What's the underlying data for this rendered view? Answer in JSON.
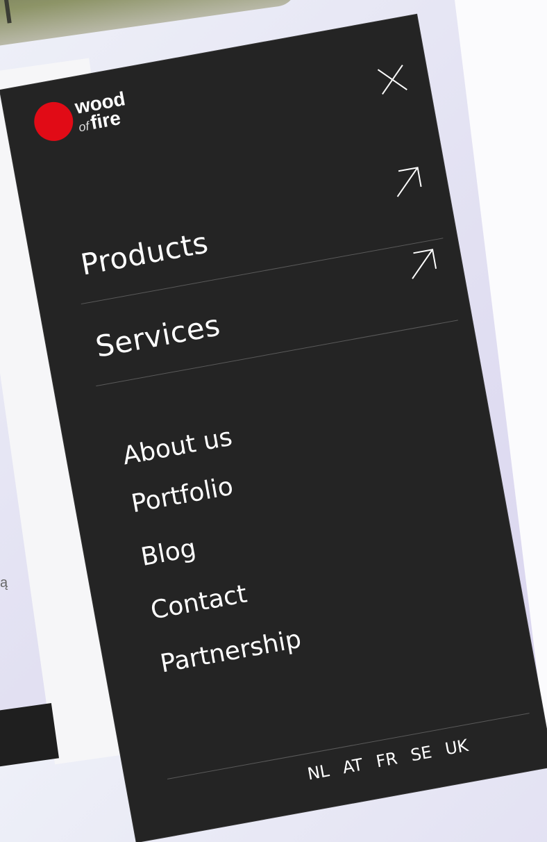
{
  "background": {
    "left_text": "ą"
  },
  "menu": {
    "logo": {
      "top": "wood",
      "of": "of",
      "bottom": "fire",
      "accent_color": "#e10b16"
    },
    "close_icon": "close-icon",
    "main_items": [
      {
        "label": "Products",
        "icon": "arrow-up-right-icon"
      },
      {
        "label": "Services",
        "icon": "arrow-up-right-icon"
      }
    ],
    "links": [
      "About us",
      "Portfolio",
      "Blog",
      "Contact",
      "Partnership"
    ],
    "languages": [
      "NL",
      "AT",
      "FR",
      "SE",
      "UK"
    ]
  }
}
